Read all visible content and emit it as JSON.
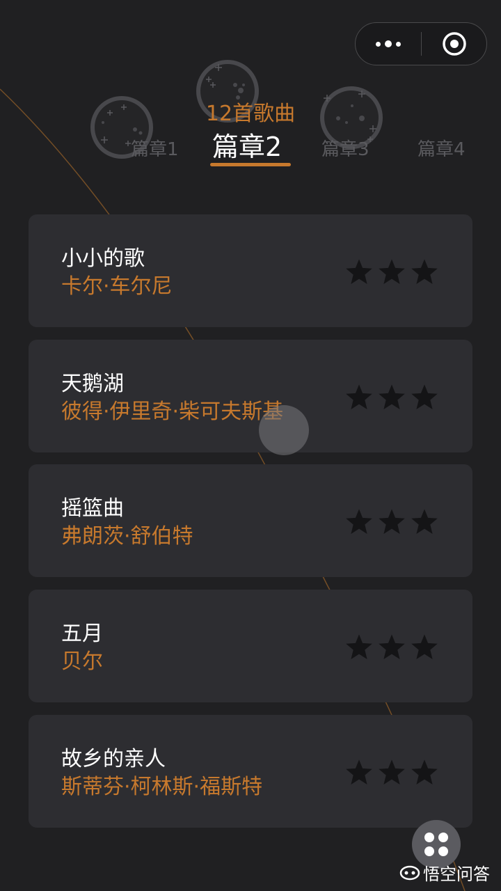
{
  "header": {
    "song_count": "12首歌曲",
    "tabs": [
      {
        "label": "篇章1"
      },
      {
        "label": "篇章2",
        "active": true
      },
      {
        "label": "篇章3"
      },
      {
        "label": "篇章4"
      }
    ]
  },
  "capsule": {
    "more_icon": "more-dots-icon",
    "close_icon": "target-circle-icon"
  },
  "songs": [
    {
      "title": "小小的歌",
      "composer": "卡尔·车尔尼",
      "stars": 3,
      "stars_earned": 0
    },
    {
      "title": "天鹅湖",
      "composer": "彼得·伊里奇·柴可夫斯基",
      "stars": 3,
      "stars_earned": 0
    },
    {
      "title": "摇篮曲",
      "composer": "弗朗茨·舒伯特",
      "stars": 3,
      "stars_earned": 0
    },
    {
      "title": "五月",
      "composer": "贝尔",
      "stars": 3,
      "stars_earned": 0
    },
    {
      "title": "故乡的亲人",
      "composer": "斯蒂芬·柯林斯·福斯特",
      "stars": 3,
      "stars_earned": 0
    }
  ],
  "watermark": {
    "text": "悟空问答",
    "icon": "wukong-logo-icon"
  },
  "colors": {
    "background": "#202022",
    "card": "#2d2d31",
    "accent": "#c7792d",
    "star_empty": "#141416"
  }
}
